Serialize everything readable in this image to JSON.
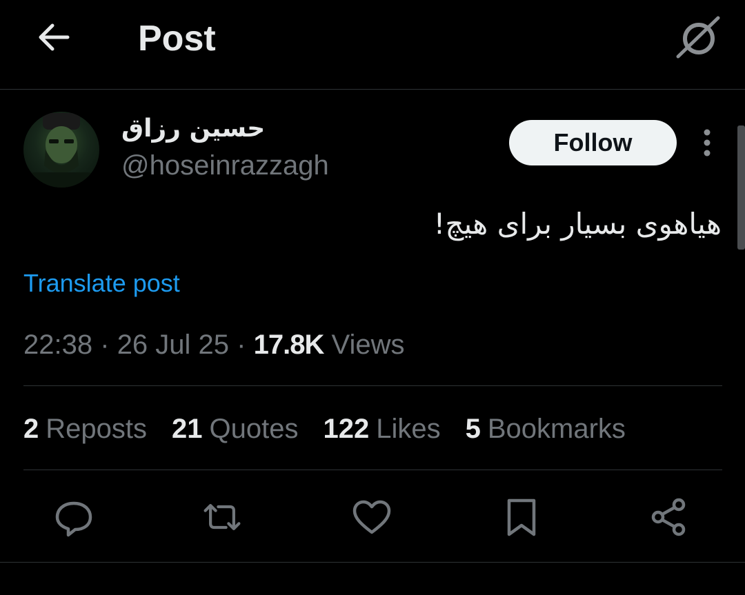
{
  "header": {
    "title": "Post",
    "back_icon": "arrow-left-icon",
    "grok_icon": "grok-icon"
  },
  "author": {
    "display_name": "حسین رزاق",
    "handle": "@hoseinrazzagh",
    "follow_label": "Follow"
  },
  "post": {
    "text": "هیاهوی بسیار برای هیچ!",
    "translate_label": "Translate post",
    "time": "22:38",
    "date": "26 Jul 25",
    "views_count": "17.8K",
    "views_label": "Views",
    "separator": "·"
  },
  "stats": [
    {
      "count": "2",
      "label": "Reposts"
    },
    {
      "count": "21",
      "label": "Quotes"
    },
    {
      "count": "122",
      "label": "Likes"
    },
    {
      "count": "5",
      "label": "Bookmarks"
    }
  ],
  "actions": [
    "reply-icon",
    "repost-icon",
    "like-icon",
    "bookmark-icon",
    "share-icon"
  ],
  "colors": {
    "background": "#000000",
    "text": "#e7e9ea",
    "secondary": "#71767b",
    "link": "#1d9bf0",
    "divider": "#2f3336"
  }
}
